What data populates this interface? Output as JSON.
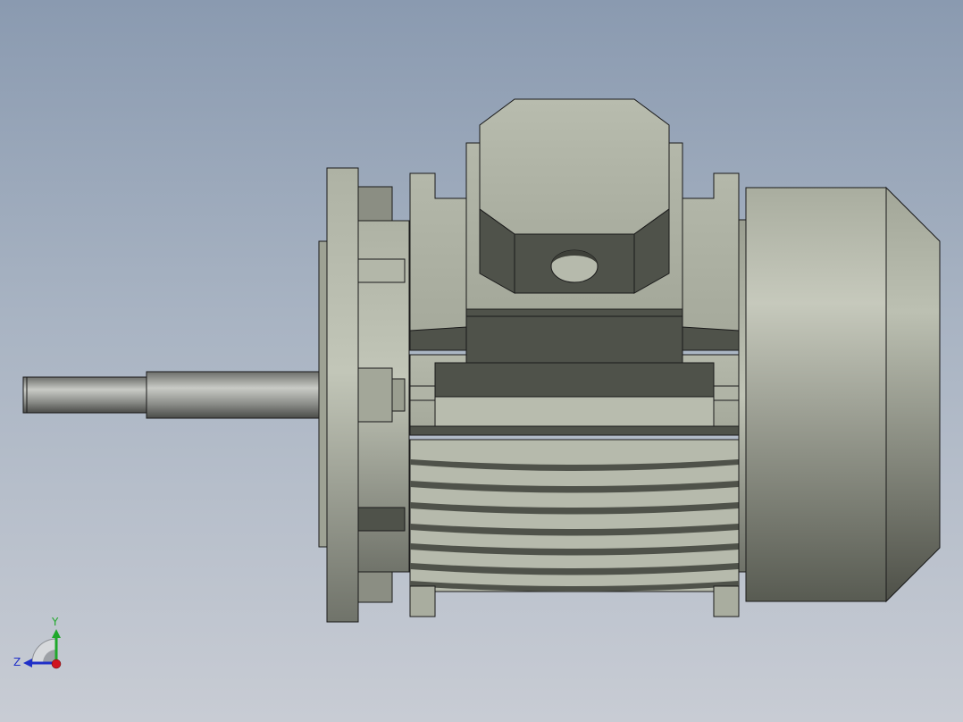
{
  "view": {
    "background_top": "#8a9ab0",
    "background_bottom": "#c8ccd4"
  },
  "model": {
    "body_color": "#b9bdaf",
    "shadow_color": "#505349",
    "edge_color": "#1a1a1a"
  },
  "triad": {
    "y_label": "Y",
    "z_label": "Z",
    "y_color": "#1fa82a",
    "z_color": "#1f2fc8",
    "x_color": "#d0141e"
  }
}
